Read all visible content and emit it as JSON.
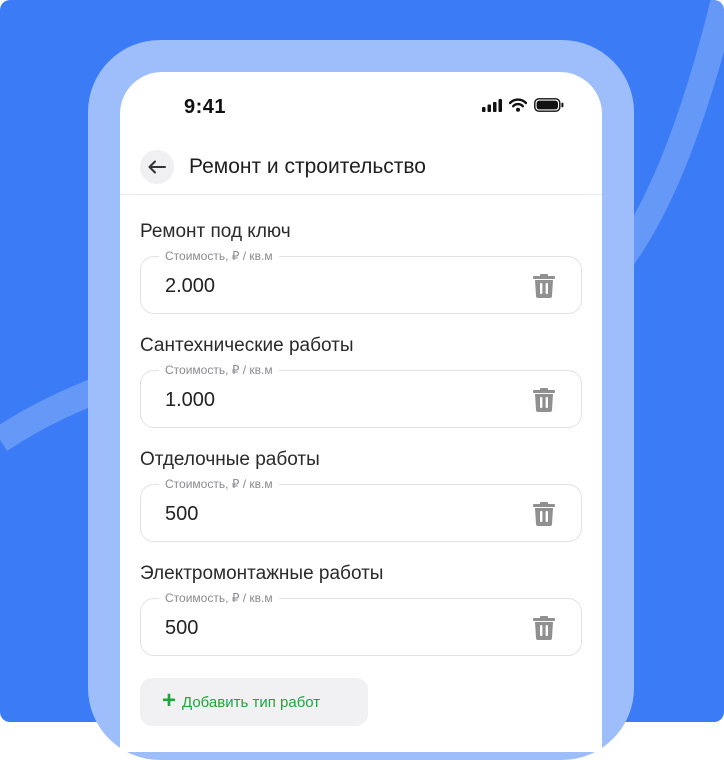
{
  "colors": {
    "background": "#3B7CF6",
    "frame": "#9DBDFB",
    "accent": "#1FA63A"
  },
  "status_bar": {
    "time": "9:41",
    "icons": [
      "signal-icon",
      "wifi-icon",
      "battery-icon"
    ]
  },
  "header": {
    "title": "Ремонт и строительство",
    "back_icon": "arrow-left-icon"
  },
  "field_label": "Стоимость, ₽ / кв.м",
  "sections": [
    {
      "title": "Ремонт под ключ",
      "value": "2.000"
    },
    {
      "title": "Сантехнические работы",
      "value": "1.000"
    },
    {
      "title": "Отделочные работы",
      "value": "500"
    },
    {
      "title": "Электромонтажные работы",
      "value": "500"
    }
  ],
  "add_button": {
    "label": "Добавить тип работ",
    "icon": "plus-icon"
  }
}
